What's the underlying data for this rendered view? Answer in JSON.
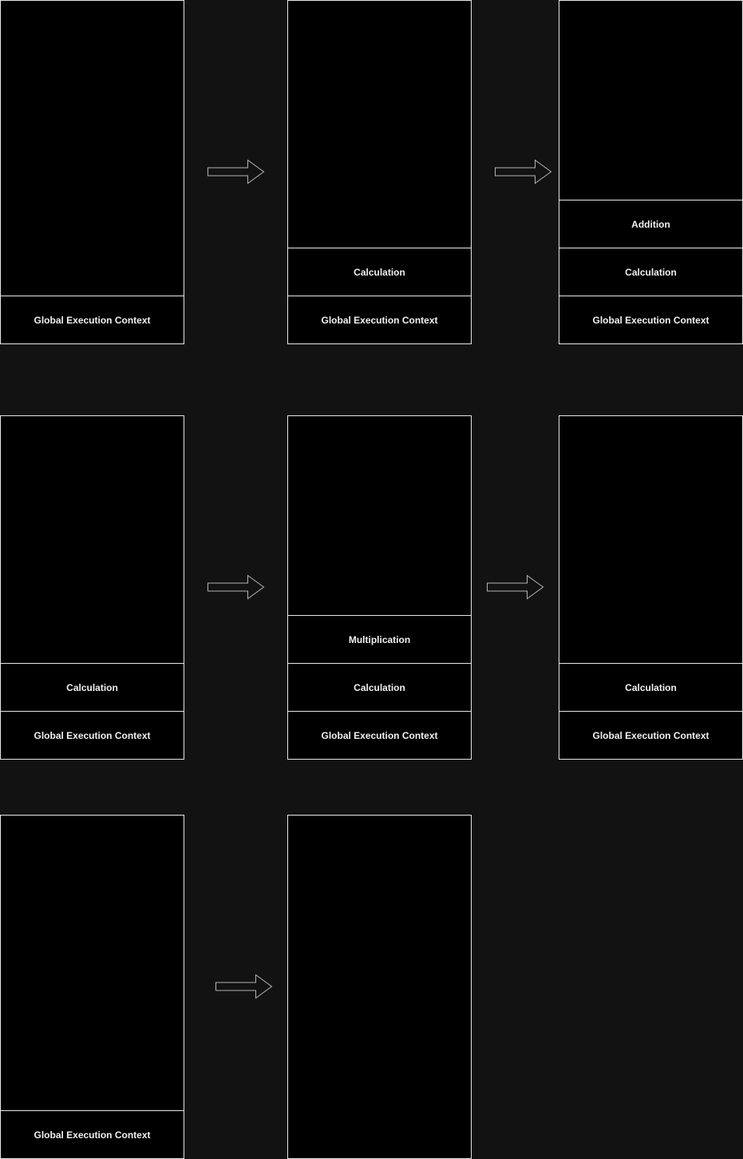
{
  "stacks": [
    {
      "frames": [
        "Global Execution Context"
      ]
    },
    {
      "frames": [
        "Global Execution Context",
        "Calculation"
      ]
    },
    {
      "frames": [
        "Global Execution Context",
        "Calculation",
        "Addition"
      ]
    },
    {
      "frames": [
        "Global Execution Context",
        "Calculation"
      ]
    },
    {
      "frames": [
        "Global Execution Context",
        "Calculation",
        "Multiplication"
      ]
    },
    {
      "frames": [
        "Global Execution Context",
        "Calculation"
      ]
    },
    {
      "frames": [
        "Global Execution Context"
      ]
    },
    {
      "frames": []
    }
  ],
  "arrows": [
    {
      "from": 0,
      "to": 1
    },
    {
      "from": 1,
      "to": 2
    },
    {
      "from": 3,
      "to": 4
    },
    {
      "from": 4,
      "to": 5
    },
    {
      "from": 6,
      "to": 7
    }
  ],
  "colors": {
    "background": "#121212",
    "box": "#000000",
    "border": "#e6e6e6",
    "arrow": "#b3b3b3"
  }
}
